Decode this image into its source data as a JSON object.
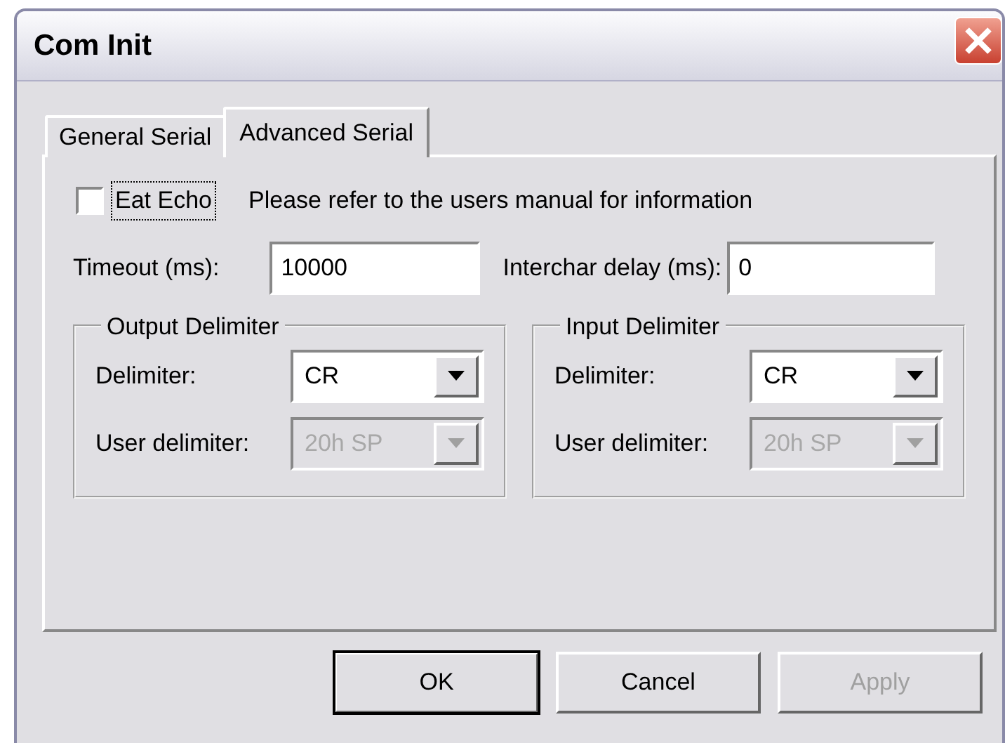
{
  "window": {
    "title": "Com Init"
  },
  "tabs": [
    {
      "label": "General Serial",
      "selected": false
    },
    {
      "label": "Advanced Serial",
      "selected": true
    }
  ],
  "eat_echo": {
    "label": "Eat Echo",
    "checked": false,
    "focused": true
  },
  "info": "Please refer to the users manual for information",
  "fields": [
    {
      "label": "Timeout (ms):",
      "value": "10000"
    },
    {
      "label": "Interchar delay (ms):",
      "value": "0"
    }
  ],
  "groups": [
    {
      "title": "Output Delimiter",
      "rows": [
        {
          "label": "Delimiter:",
          "value": "CR",
          "disabled": false
        },
        {
          "label": "User delimiter:",
          "value": "20h  SP",
          "disabled": true
        }
      ]
    },
    {
      "title": "Input Delimiter",
      "rows": [
        {
          "label": "Delimiter:",
          "value": "CR",
          "disabled": false
        },
        {
          "label": "User delimiter:",
          "value": "20h  SP",
          "disabled": true
        }
      ]
    }
  ],
  "buttons": [
    {
      "label": "OK",
      "default": true,
      "disabled": false
    },
    {
      "label": "Cancel",
      "default": false,
      "disabled": false
    },
    {
      "label": "Apply",
      "default": false,
      "disabled": true
    }
  ]
}
